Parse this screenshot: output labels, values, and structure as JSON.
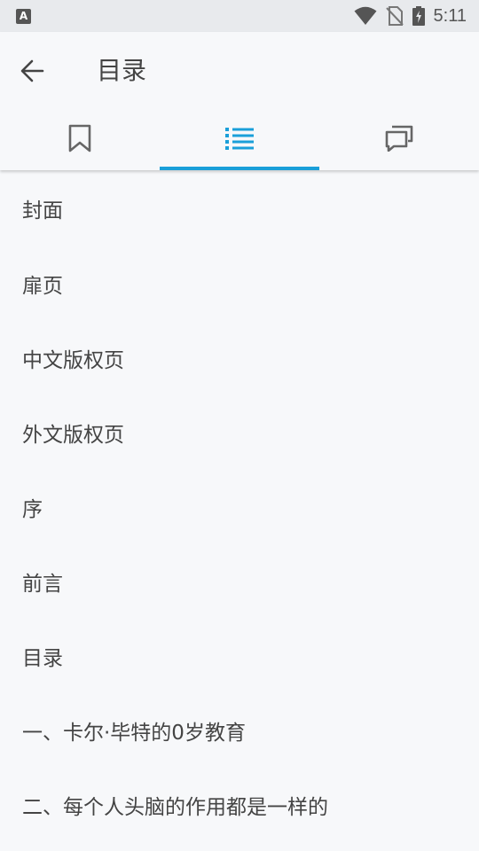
{
  "statusbar": {
    "app_icon_letter": "A",
    "time": "5:11"
  },
  "header": {
    "title": "目录",
    "tabs": [
      {
        "icon": "bookmark-icon",
        "active": false
      },
      {
        "icon": "list-icon",
        "active": true
      },
      {
        "icon": "comments-icon",
        "active": false
      }
    ]
  },
  "toc": {
    "items": [
      "封面",
      "扉页",
      "中文版权页",
      "外文版权页",
      "序",
      "前言",
      "目录",
      "一、卡尔·毕特的0岁教育",
      "二、每个人头脑的作用都是一样的"
    ]
  },
  "colors": {
    "accent": "#1a9fd9",
    "icon_gray": "#666666",
    "background": "#f7f8fa",
    "statusbar": "#e8eaed"
  }
}
